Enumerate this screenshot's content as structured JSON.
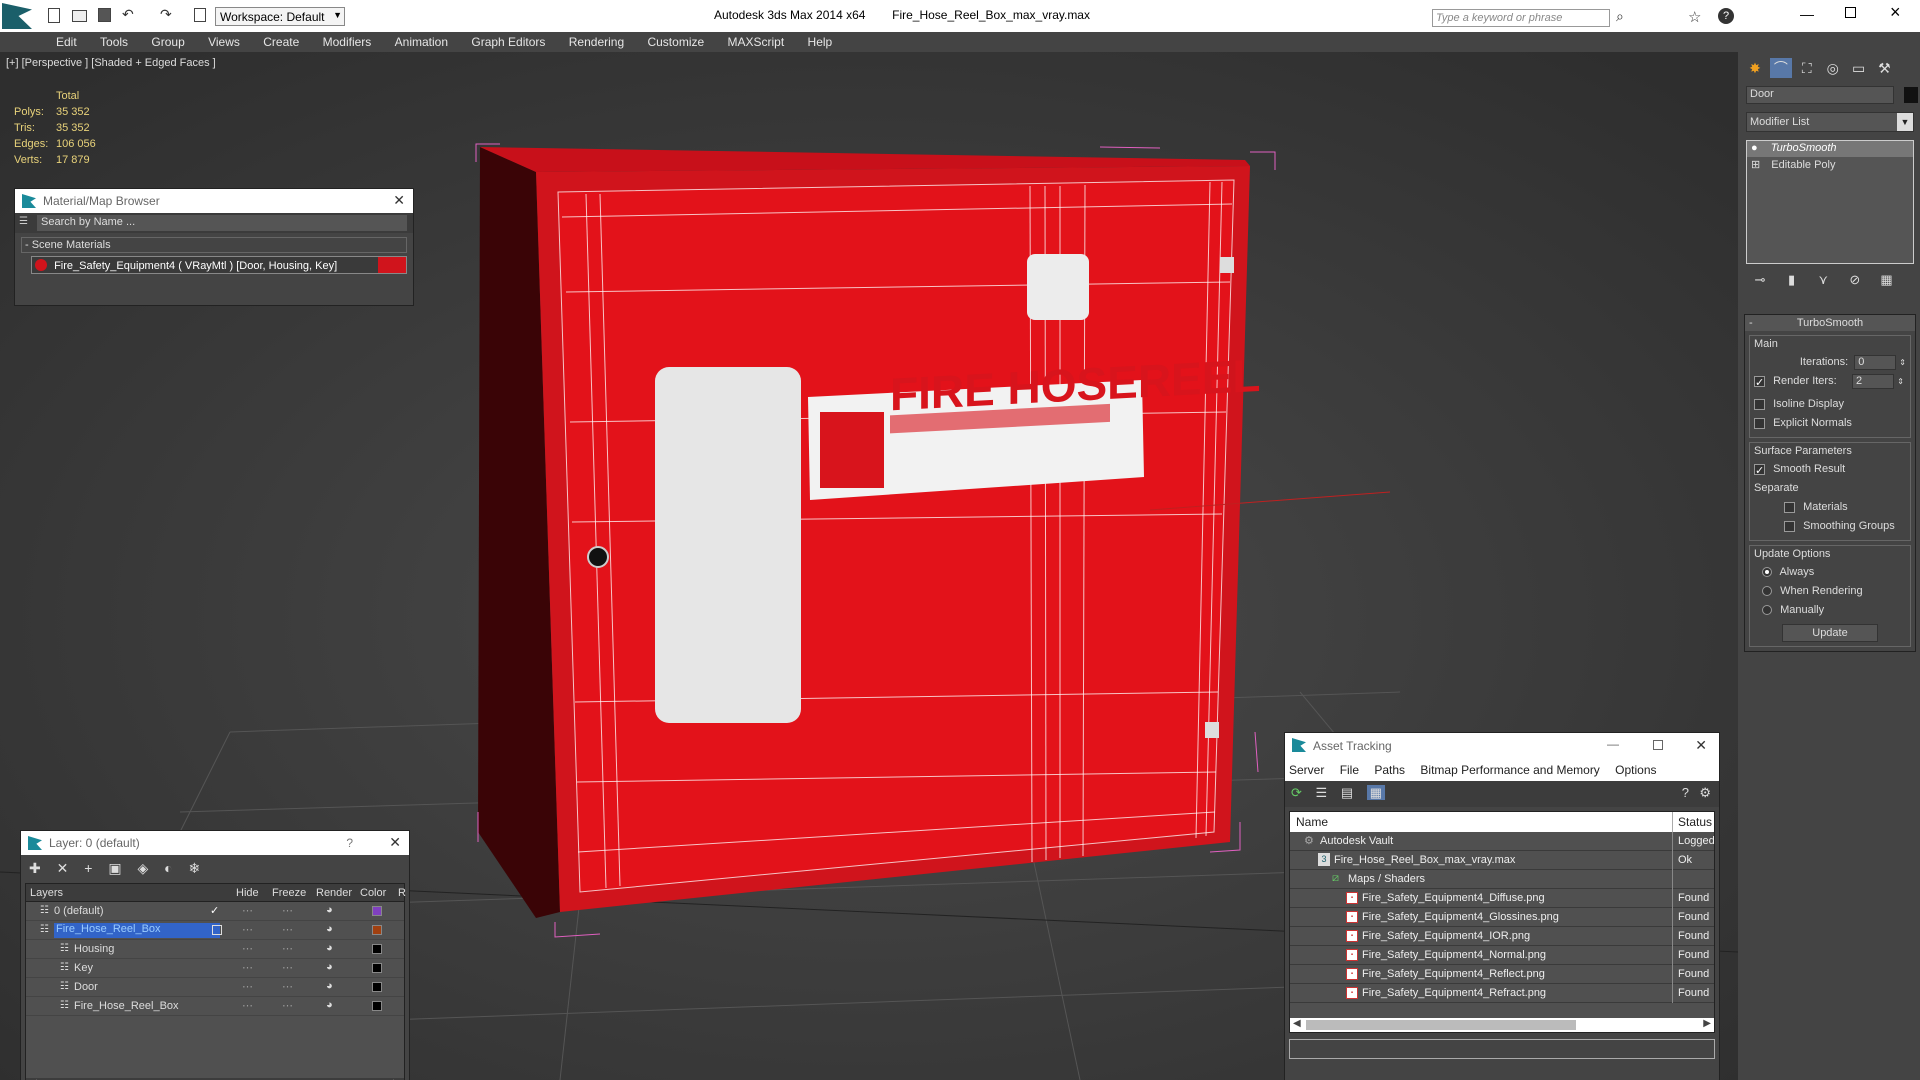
{
  "app": {
    "title": "Autodesk 3ds Max  2014 x64",
    "filename": "Fire_Hose_Reel_Box_max_vray.max",
    "workspace": "Workspace: Default",
    "search_placeholder": "Type a keyword or phrase"
  },
  "menu": [
    "Edit",
    "Tools",
    "Group",
    "Views",
    "Create",
    "Modifiers",
    "Animation",
    "Graph Editors",
    "Rendering",
    "Customize",
    "MAXScript",
    "Help"
  ],
  "viewport": {
    "label": "[+] [Perspective ] [Shaded + Edged Faces ]",
    "stats": {
      "header": "Total",
      "rows": [
        {
          "label": "Polys:",
          "value": "35 352"
        },
        {
          "label": "Tris:",
          "value": "35 352"
        },
        {
          "label": "Edges:",
          "value": "106 056"
        },
        {
          "label": "Verts:",
          "value": "17 879"
        }
      ]
    },
    "box_text": "FIRE HOSEREEL",
    "colors": {
      "box": "#e3121a",
      "box_dark": "#a30c12",
      "wire": "#ffffff",
      "select": "#e060c0",
      "stat_text": "#e8d27a"
    }
  },
  "material_browser": {
    "title": "Material/Map Browser",
    "search_placeholder": "Search by Name ...",
    "group": "- Scene Materials",
    "item": "Fire_Safety_Equipment4  ( VRayMtl )  [Door, Housing, Key]"
  },
  "layer_panel": {
    "title": "Layer: 0 (default)",
    "help": "?",
    "columns": [
      "Layers",
      "Hide",
      "Freeze",
      "Render",
      "Color",
      "R"
    ],
    "rows": [
      {
        "name": "0 (default)",
        "indent": 1,
        "checked": true,
        "color": "#8040c0"
      },
      {
        "name": "Fire_Hose_Reel_Box",
        "indent": 1,
        "selected": true,
        "color": "#a04010"
      },
      {
        "name": "Housing",
        "indent": 2,
        "color": "#000000"
      },
      {
        "name": "Key",
        "indent": 2,
        "color": "#000000"
      },
      {
        "name": "Door",
        "indent": 2,
        "color": "#000000"
      },
      {
        "name": "Fire_Hose_Reel_Box",
        "indent": 2,
        "color": "#000000"
      }
    ]
  },
  "asset_tracking": {
    "title": "Asset Tracking",
    "menu": [
      "Server",
      "File",
      "Paths",
      "Bitmap Performance and Memory",
      "Options"
    ],
    "columns": [
      "Name",
      "Status"
    ],
    "rows": [
      {
        "name": "Autodesk Vault",
        "status": "Logged",
        "indent": 1
      },
      {
        "name": "Fire_Hose_Reel_Box_max_vray.max",
        "status": "Ok",
        "indent": 2
      },
      {
        "name": "Maps / Shaders",
        "status": "",
        "indent": 3
      },
      {
        "name": "Fire_Safety_Equipment4_Diffuse.png",
        "status": "Found",
        "indent": 4
      },
      {
        "name": "Fire_Safety_Equipment4_Glossines.png",
        "status": "Found",
        "indent": 4
      },
      {
        "name": "Fire_Safety_Equipment4_IOR.png",
        "status": "Found",
        "indent": 4
      },
      {
        "name": "Fire_Safety_Equipment4_Normal.png",
        "status": "Found",
        "indent": 4
      },
      {
        "name": "Fire_Safety_Equipment4_Reflect.png",
        "status": "Found",
        "indent": 4
      },
      {
        "name": "Fire_Safety_Equipment4_Refract.png",
        "status": "Found",
        "indent": 4
      }
    ]
  },
  "command_panel": {
    "object_name": "Door",
    "modifier_list": "Modifier List",
    "stack": [
      "TurboSmooth",
      "Editable Poly"
    ],
    "rollout_title": "TurboSmooth",
    "main_label": "Main",
    "iterations_label": "Iterations:",
    "iterations_value": "0",
    "render_iters_label": "Render Iters:",
    "render_iters_value": "2",
    "isoline": "Isoline Display",
    "explicit": "Explicit Normals",
    "surface_params": "Surface Parameters",
    "smooth_result": "Smooth Result",
    "separate": "Separate",
    "materials": "Materials",
    "smoothing_groups": "Smoothing Groups",
    "update_options": "Update Options",
    "always": "Always",
    "when_rendering": "When Rendering",
    "manually": "Manually",
    "update_btn": "Update"
  }
}
